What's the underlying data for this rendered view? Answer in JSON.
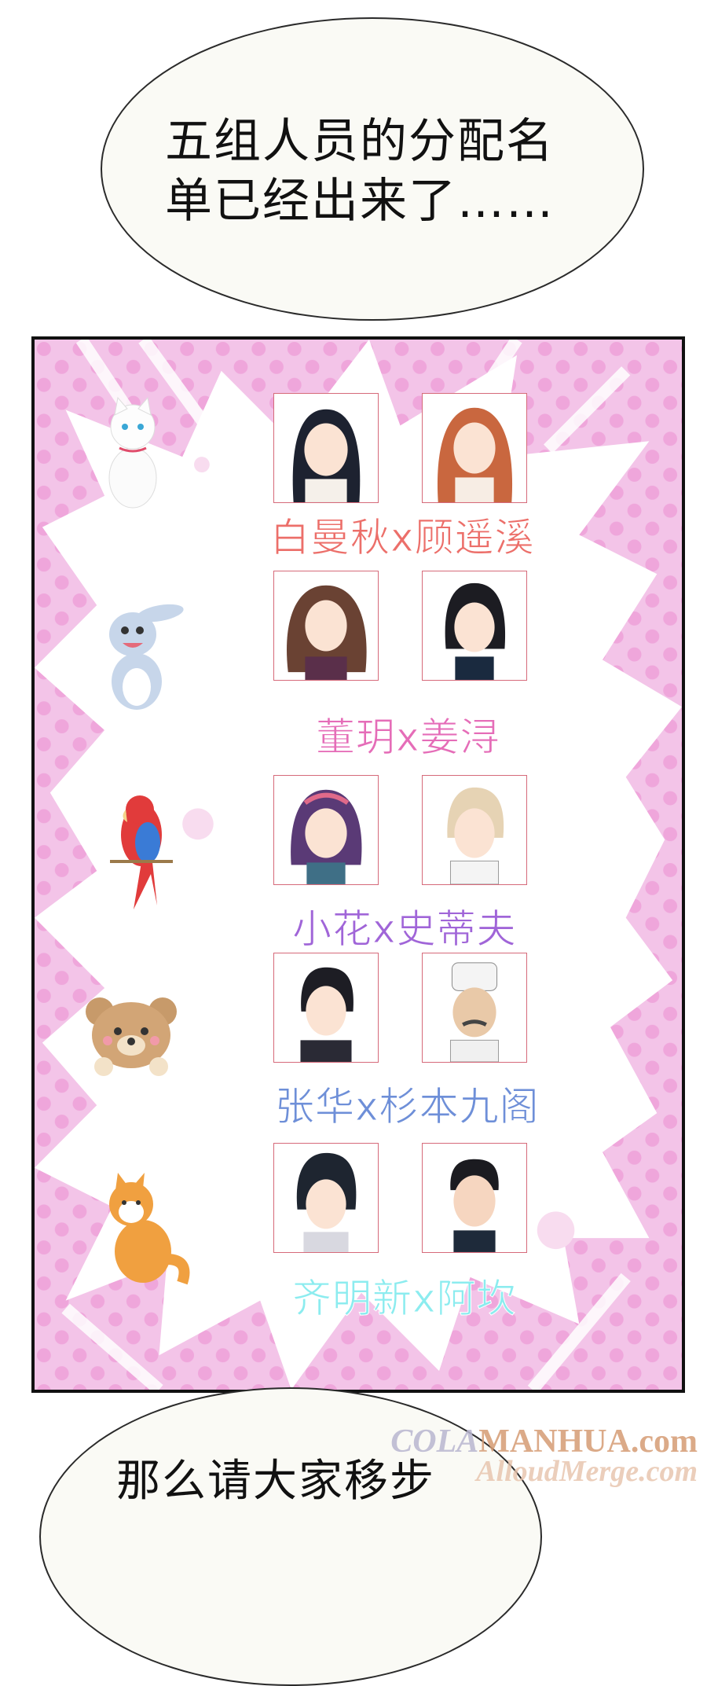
{
  "top_bubble": {
    "line1": "五组人员的分配名",
    "line2": "单已经出来了……"
  },
  "bottom_bubble": {
    "text": "那么请大家移步"
  },
  "pairs": [
    {
      "pet": "cat-icon",
      "label": "白曼秋x顾遥溪",
      "color": "#ec6f6a"
    },
    {
      "pet": "rabbit-icon",
      "label": "董玥x姜浔",
      "color": "#e56db8"
    },
    {
      "pet": "parrot-icon",
      "label": "小花x史蒂夫",
      "color": "#a065d8"
    },
    {
      "pet": "bear-icon",
      "label": "张华x杉本九阁",
      "color": "#6e8fd8"
    },
    {
      "pet": "shiba-dog-icon",
      "label": "齐明新x阿坎",
      "color": "#8cecef"
    }
  ],
  "watermark": {
    "prefix": "COLA",
    "site": "MANHUA.com",
    "line2": "AlloudMerge.com"
  },
  "colors": {
    "panel_bg": "#f3c4e8",
    "burst": "#ffffff",
    "dots": "#ee9fd8"
  }
}
